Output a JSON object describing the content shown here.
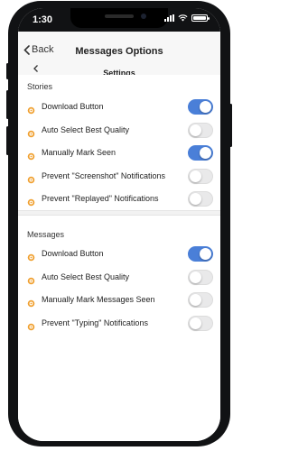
{
  "status_bar": {
    "time": "1:30"
  },
  "nav": {
    "back_label": "Back",
    "title": "Messages Options",
    "subtitle": "Settings"
  },
  "sections": [
    {
      "header": "Stories",
      "items": [
        {
          "label": "Download Button",
          "enabled": true
        },
        {
          "label": "Auto Select Best Quality",
          "enabled": false
        },
        {
          "label": "Manually Mark Seen",
          "enabled": true
        },
        {
          "label": "Prevent \"Screenshot\" Notifications",
          "enabled": false
        },
        {
          "label": "Prevent \"Replayed\" Notifications",
          "enabled": false
        }
      ]
    },
    {
      "header": "Messages",
      "items": [
        {
          "label": "Download Button",
          "enabled": true
        },
        {
          "label": "Auto Select Best Quality",
          "enabled": false
        },
        {
          "label": "Manually Mark Messages Seen",
          "enabled": false
        },
        {
          "label": "Prevent \"Typing\" Notifications",
          "enabled": false
        }
      ]
    }
  ],
  "colors": {
    "accent": "#4a7fd8",
    "icon": "#f0a030",
    "toggle_off": "#e9e9ea"
  },
  "icons": {
    "row_icon": "settings-icon",
    "back_icon": "chevron-left-icon"
  }
}
